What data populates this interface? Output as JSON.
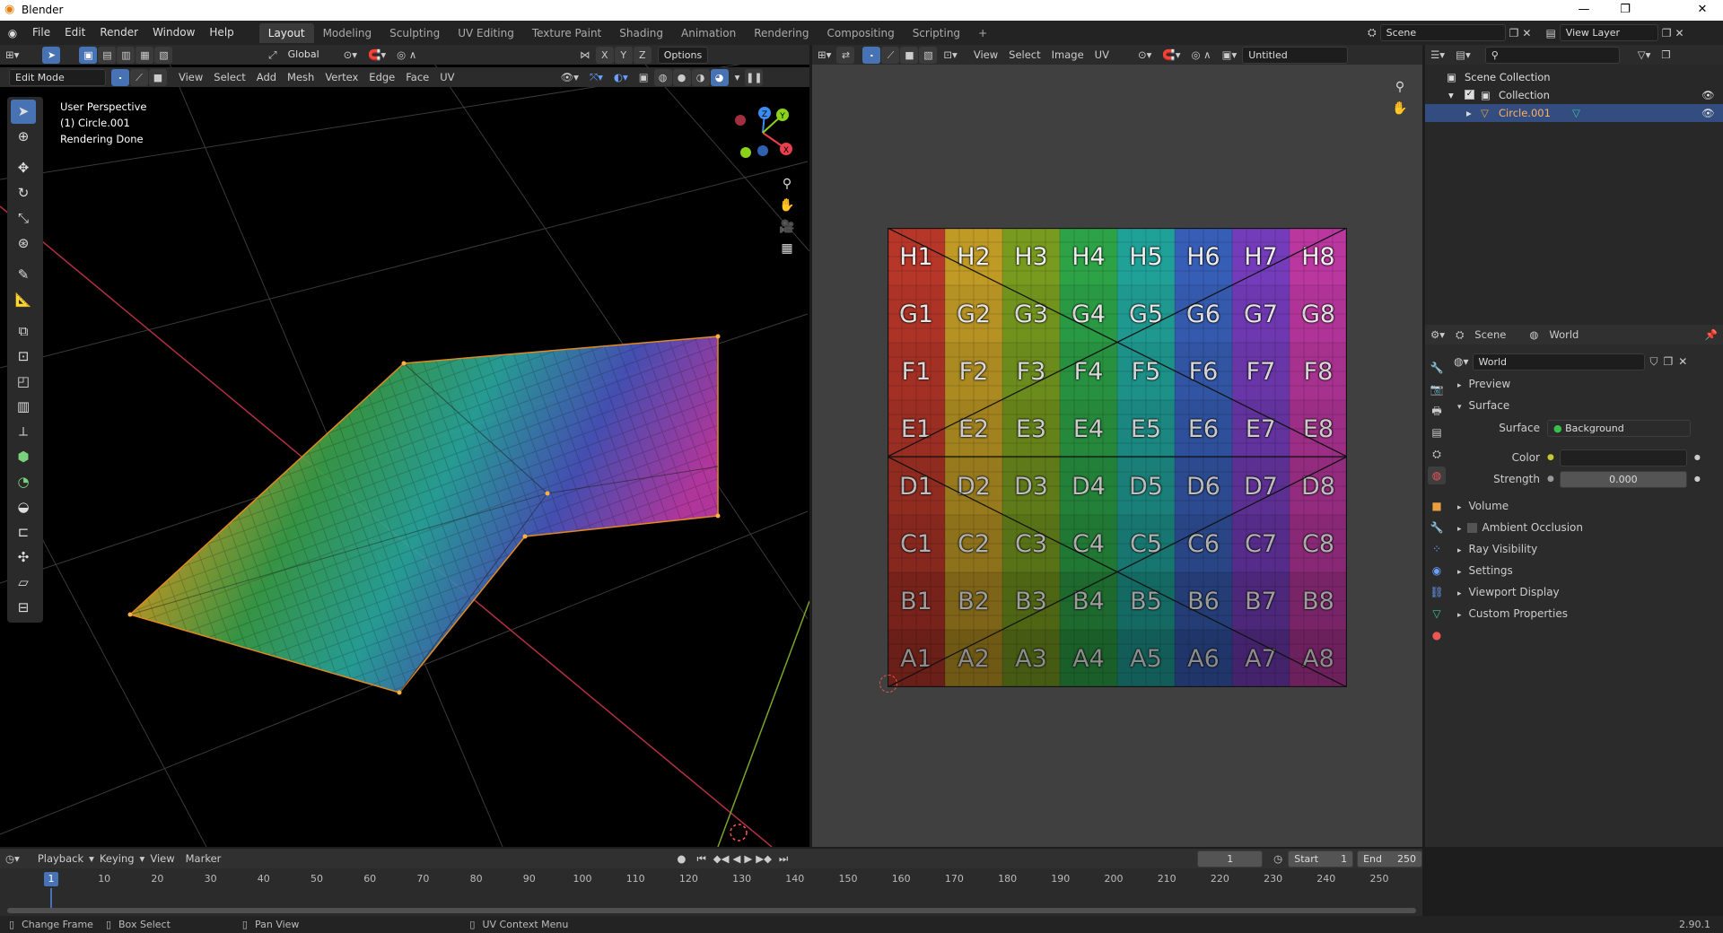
{
  "app": {
    "title": "Blender",
    "version": "2.90.1"
  },
  "window_controls": {
    "minimize": "—",
    "restore": "❐",
    "close": "✕"
  },
  "menus": [
    "File",
    "Edit",
    "Render",
    "Window",
    "Help"
  ],
  "workspaces": [
    "Layout",
    "Modeling",
    "Sculpting",
    "UV Editing",
    "Texture Paint",
    "Shading",
    "Animation",
    "Rendering",
    "Compositing",
    "Scripting"
  ],
  "active_workspace": "Layout",
  "scene_field": "Scene",
  "view_layer_field": "View Layer",
  "viewport": {
    "orientation": "Global",
    "options_label": "Options",
    "mode": "Edit Mode",
    "header_menus": [
      "View",
      "Select",
      "Add",
      "Mesh",
      "Vertex",
      "Edge",
      "Face",
      "UV"
    ],
    "overlay_lines": [
      "User Perspective",
      "(1) Circle.001",
      "Rendering Done"
    ],
    "gizmo_axes": {
      "x": "X",
      "y": "Y",
      "z": "Z"
    },
    "colors": {
      "x": "#e8404c",
      "y": "#8bd21a",
      "z": "#3b8cf0",
      "x_line": "#b03040",
      "y_line": "#7aa52a"
    }
  },
  "uv_editor": {
    "menus": [
      "View",
      "Select",
      "Image",
      "UV"
    ],
    "image_name": "Untitled",
    "grid_rows": [
      [
        "H1",
        "H2",
        "H3",
        "H4",
        "H5",
        "H6",
        "H7",
        "H8"
      ],
      [
        "G1",
        "G2",
        "G3",
        "G4",
        "G5",
        "G6",
        "G7",
        "G8"
      ],
      [
        "F1",
        "F2",
        "F3",
        "F4",
        "F5",
        "F6",
        "F7",
        "F8"
      ],
      [
        "E1",
        "E2",
        "E3",
        "E4",
        "E5",
        "E6",
        "E7",
        "E8"
      ],
      [
        "D1",
        "D2",
        "D3",
        "D4",
        "D5",
        "D6",
        "D7",
        "D8"
      ],
      [
        "C1",
        "C2",
        "C3",
        "C4",
        "C5",
        "C6",
        "C7",
        "C8"
      ],
      [
        "B1",
        "B2",
        "B3",
        "B4",
        "B5",
        "B6",
        "B7",
        "B8"
      ],
      [
        "A1",
        "A2",
        "A3",
        "A4",
        "A5",
        "A6",
        "A7",
        "A8"
      ]
    ],
    "column_colors": [
      "#c0392b",
      "#c9a227",
      "#7ea321",
      "#2faa4a",
      "#22a9a0",
      "#3a63c0",
      "#7a3fc4",
      "#c43aa8"
    ]
  },
  "outliner": {
    "root": "Scene Collection",
    "collection": "Collection",
    "object": "Circle.001"
  },
  "properties": {
    "tabs": [
      "Scene",
      "World"
    ],
    "world_name": "World",
    "panels": [
      "Preview",
      "Surface"
    ],
    "surface_label": "Surface",
    "surface_value": "Background",
    "color_label": "Color",
    "strength_label": "Strength",
    "strength_value": "0.000",
    "subpanels": [
      "Volume",
      "Ambient Occlusion",
      "Ray Visibility",
      "Settings",
      "Viewport Display",
      "Custom Properties"
    ]
  },
  "timeline": {
    "menus": [
      "Playback",
      "Keying",
      "View",
      "Marker"
    ],
    "current_frame": "1",
    "start_label": "Start",
    "start": "1",
    "end_label": "End",
    "end": "250",
    "ticks": [
      "10",
      "20",
      "30",
      "40",
      "50",
      "60",
      "70",
      "80",
      "90",
      "100",
      "110",
      "120",
      "130",
      "140",
      "150",
      "160",
      "170",
      "180",
      "190",
      "200",
      "210",
      "220",
      "230",
      "240",
      "250"
    ],
    "playhead": "1"
  },
  "statusbar": {
    "items": [
      "Change Frame",
      "Box Select",
      "Pan View",
      "UV Context Menu"
    ]
  }
}
